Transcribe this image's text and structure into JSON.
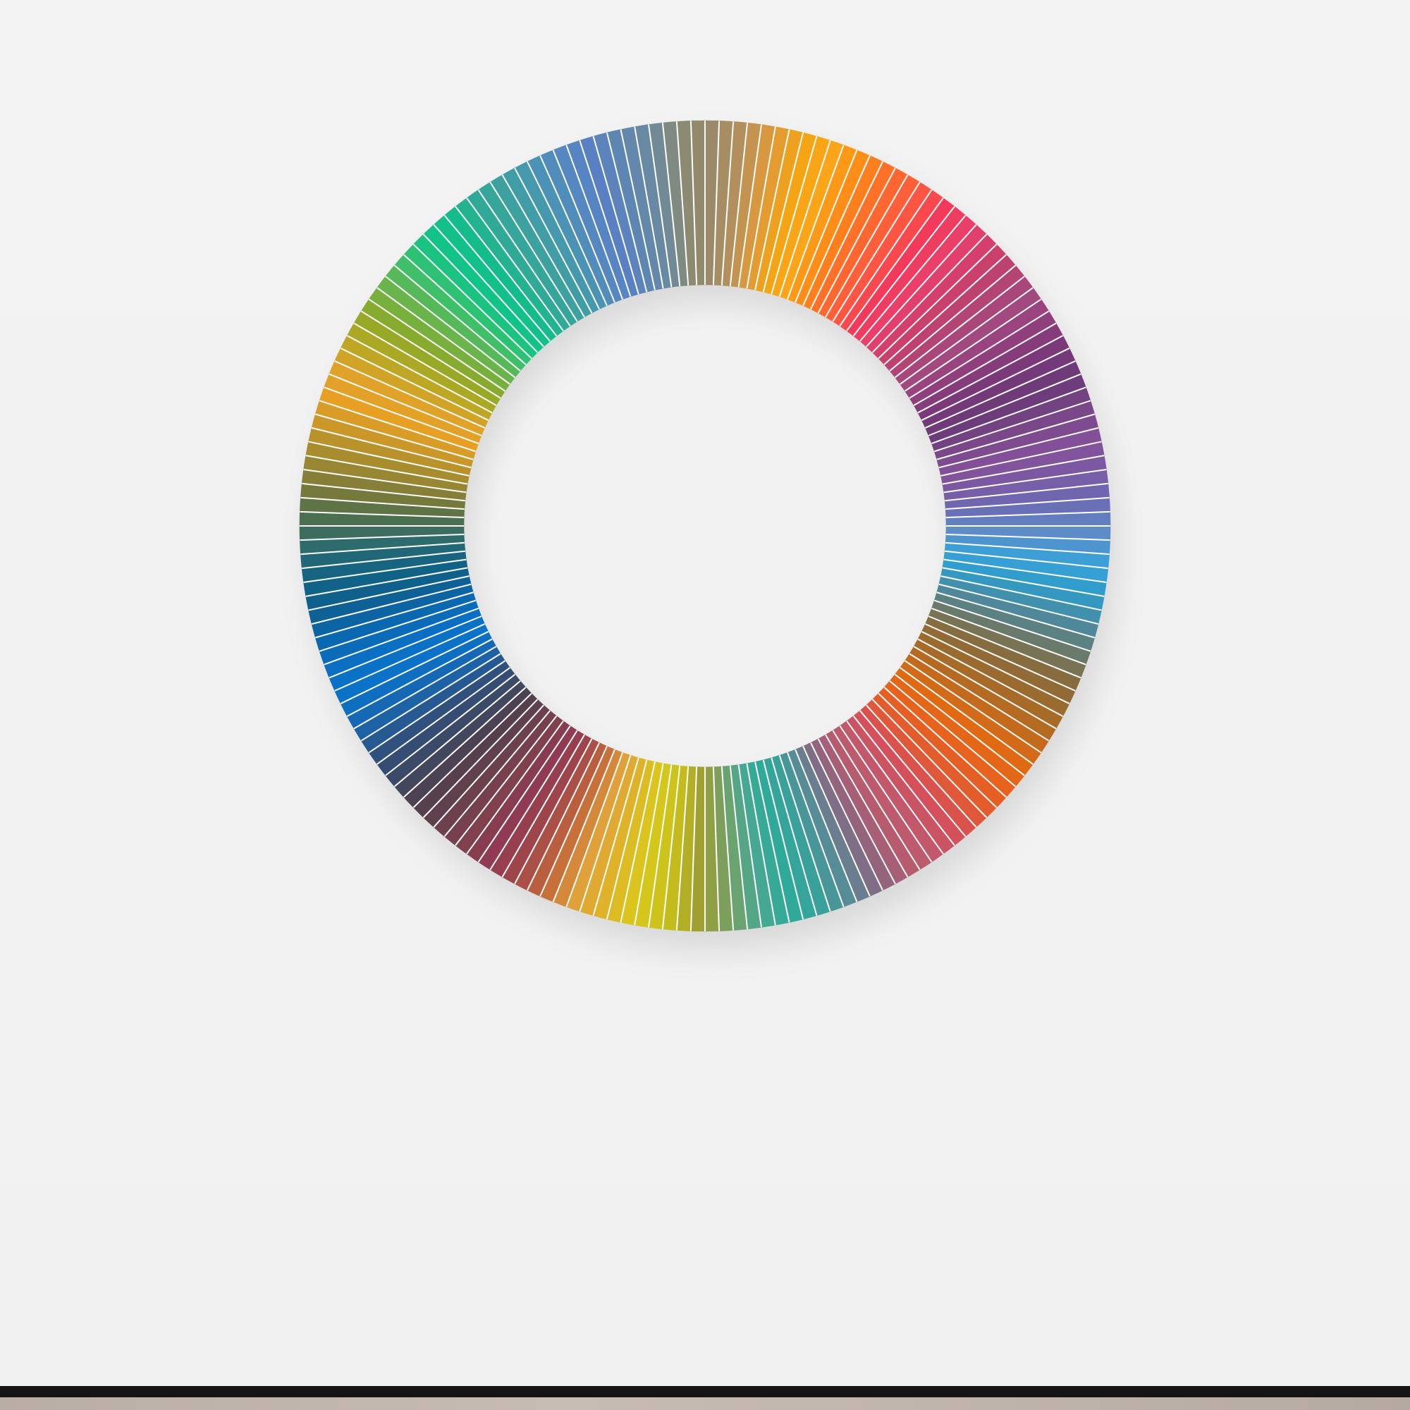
{
  "scene": {
    "wall_color": "#f2f2f2",
    "floor_edge_color": "#141414",
    "floor_color": "#c0b5ad",
    "separator_color": "#ffffff"
  },
  "artwork": {
    "segment_count": 180,
    "start_angle_deg": -90,
    "direction": "clockwise",
    "color_stops": [
      "#9a8a6a",
      "#b7905c",
      "#e09a38",
      "#f4a512",
      "#fda518",
      "#ff8a18",
      "#ff6a2c",
      "#ff5a40",
      "#f43a5a",
      "#e8406a",
      "#cf3f6c",
      "#b54472",
      "#a24a80",
      "#8e3c7c",
      "#763878",
      "#6a3c78",
      "#7a4788",
      "#84509a",
      "#7a5aa4",
      "#6a6cb4",
      "#5e8cc8",
      "#3aa0d8",
      "#2e9cca",
      "#4a8aa0",
      "#6a7a6a",
      "#8a6a3a",
      "#a06a2a",
      "#c06a1e",
      "#e06a12",
      "#e8621e",
      "#e05a30",
      "#d6505a",
      "#c2586a",
      "#b65c70",
      "#8a6680",
      "#5a8a96",
      "#3aa09a",
      "#2eaa9a",
      "#4aa890",
      "#78a060",
      "#a0a030",
      "#c8c01a",
      "#d8c81a",
      "#e0b428",
      "#e0a03a",
      "#c46a3a",
      "#a2484a",
      "#923a52",
      "#80404c",
      "#6a404c",
      "#50404e",
      "#3c4a64",
      "#30507e",
      "#1a64aa",
      "#0a72c8",
      "#0a70c4",
      "#0a68b0",
      "#0e6090",
      "#106284",
      "#2a6a70",
      "#4a7050",
      "#7a7a3a",
      "#a08a30",
      "#c69628",
      "#e8a024",
      "#e0a22a",
      "#b4a824",
      "#8aaa2a",
      "#6ab44c",
      "#3ac06a",
      "#12c486",
      "#12be8a",
      "#30aa96",
      "#3ea0a0",
      "#4896b0",
      "#5488c0",
      "#5a80c4",
      "#5f87b0",
      "#6a8aa0",
      "#8a8a72",
      "#9a8a6a"
    ]
  }
}
